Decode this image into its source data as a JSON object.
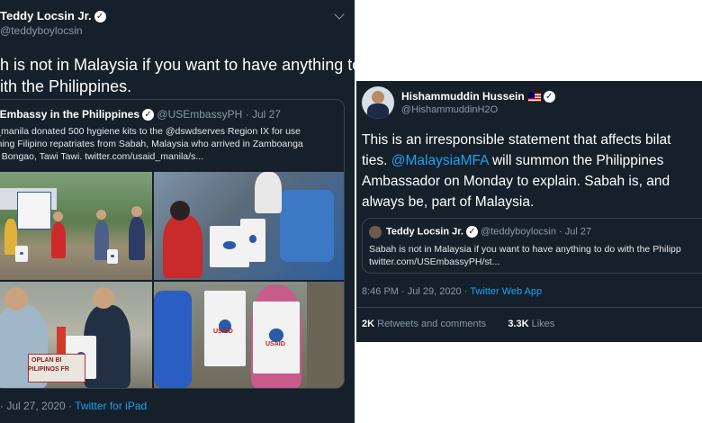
{
  "left_tweet": {
    "author_name": "Teddy Locsin Jr.",
    "handle": "@teddyboylocsin",
    "text_line1": "h is not in Malaysia if you want to have anything to",
    "text_line2": "ith the Philippines.",
    "quoted": {
      "author_name": ". Embassy in the Philippines",
      "handle": "@USEmbassyPH",
      "date": "· Jul 27",
      "line1": "l_manila donated 500 hygiene kits to the @dswdserves Region IX for use",
      "line2": "rning Filipino repatriates from Sabah, Malaysia who arrived in Zamboanga",
      "line3": "d Bongao, Tawi Tawi. twitter.com/usaid_manila/s..."
    },
    "photo_text": {
      "bag_logo": "USAID",
      "tarp_line1": "OPLAN BI",
      "tarp_line2": "PILIPINOS FR"
    },
    "meta_date": "· Jul 27, 2020 ·",
    "meta_source": "Twitter for iPad"
  },
  "right_tweet": {
    "author_name": "Hishammuddin Hussein",
    "handle": "@HishammuddinH2O",
    "text_line1": "This is an irresponsible statement that affects bilat",
    "text_line2_a": "ties. ",
    "text_line2_mention": "@MalaysiaMFA",
    "text_line2_b": " will summon the Philippines",
    "text_line3": "Ambassador on Monday to explain. Sabah is, and",
    "text_line4": "always be, part of Malaysia.",
    "quoted": {
      "author_name": "Teddy Locsin Jr.",
      "handle": "@teddyboylocsin",
      "date": "· Jul 27",
      "line1": "Sabah is not in Malaysia if you want to have anything to do with the Philipp",
      "line2": "twitter.com/USEmbassyPH/st..."
    },
    "meta_time": "8:46 PM · Jul 29, 2020 ·",
    "meta_source": "Twitter Web App",
    "retweets_count": "2K",
    "retweets_label": "Retweets and comments",
    "likes_count": "3.3K",
    "likes_label": "Likes"
  },
  "colors": {
    "background": "#15202b",
    "link": "#1da1f2",
    "muted": "#8899a6",
    "border": "#38444d"
  },
  "icons": [
    "verified-badge-icon",
    "chevron-down-icon",
    "malaysia-flag-icon"
  ]
}
